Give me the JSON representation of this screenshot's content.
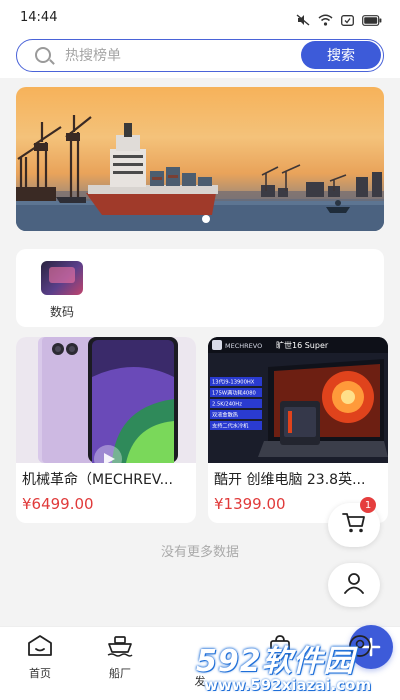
{
  "status_bar": {
    "time": "14:44",
    "icons": [
      "mute-icon",
      "wifi-icon",
      "battery-saver-icon",
      "battery-icon"
    ]
  },
  "search": {
    "placeholder": "热搜榜单",
    "button_label": "搜索",
    "accent_color": "#3d5bd9"
  },
  "banner": {
    "image": "harbor-sunset-cargo-ship",
    "active_slide": 1,
    "slide_count": 1
  },
  "categories": [
    {
      "label": "数码",
      "icon": "digital-category-thumbnail"
    }
  ],
  "products": [
    {
      "title": "机械革命（MECHREV...",
      "price": "¥6499.00",
      "image": "iphone-purple-product-photo"
    },
    {
      "title": "酷开 创维电脑 23.8英...",
      "price": "¥1399.00",
      "image": "gaming-laptop-product-photo",
      "image_text": [
        "旷世16 Super",
        "MECHREVO",
        "13代i9-13900HX",
        "175W满功耗4080",
        "2.5K/240Hz",
        "双液金散热",
        "支持二代水冷机"
      ]
    }
  ],
  "list_footer": "没有更多数据",
  "floating_buttons": {
    "cart_badge": "1"
  },
  "bottom_nav": {
    "items": [
      {
        "label": "首页",
        "icon": "home-icon"
      },
      {
        "label": "船厂",
        "icon": "ship-icon"
      },
      {
        "label": "发",
        "icon": "plus-icon"
      },
      {
        "label": "",
        "icon": "bag-icon"
      },
      {
        "label": "",
        "icon": "profile-icon"
      }
    ]
  },
  "watermark": {
    "title": "592软件园",
    "url": "www.592xiazai.com"
  }
}
